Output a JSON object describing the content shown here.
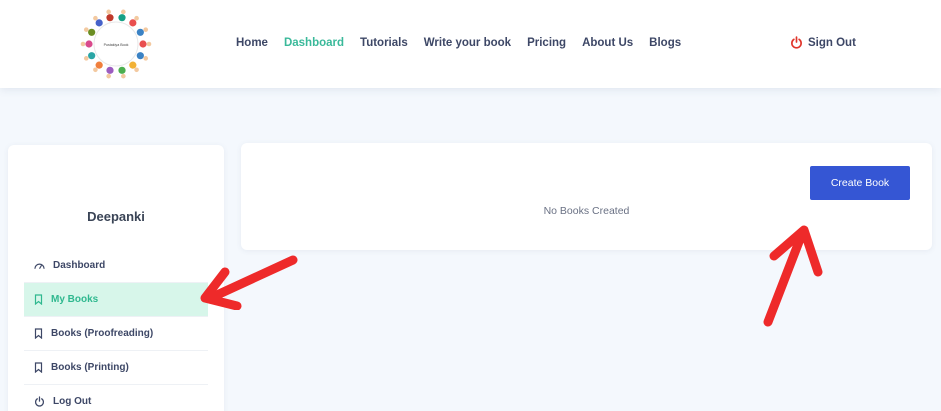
{
  "header": {
    "logo_icon": "children-circle-logo-icon",
    "logo_text": "Pustakiya Book",
    "nav": [
      {
        "label": "Home"
      },
      {
        "label": "Dashboard",
        "active": true
      },
      {
        "label": "Tutorials"
      },
      {
        "label": "Write your book"
      },
      {
        "label": "Pricing"
      },
      {
        "label": "About Us"
      },
      {
        "label": "Blogs"
      }
    ],
    "signout_label": "Sign Out",
    "signout_icon": "power-icon",
    "accent_color": "#3ab99a",
    "signout_icon_color": "#e0352b"
  },
  "sidebar": {
    "username": "Deepanki",
    "items": [
      {
        "label": "Dashboard",
        "icon": "dashboard-icon"
      },
      {
        "label": "My Books",
        "icon": "bookmark-icon",
        "active": true
      },
      {
        "label": "Books (Proofreading)",
        "icon": "bookmark-icon"
      },
      {
        "label": "Books (Printing)",
        "icon": "bookmark-icon"
      },
      {
        "label": "Log Out",
        "icon": "power-icon"
      }
    ]
  },
  "main": {
    "empty_message": "No Books Created",
    "create_button_label": "Create Book",
    "button_color": "#3556d4"
  },
  "annotations": {
    "arrow_color": "#ee2a2a"
  }
}
